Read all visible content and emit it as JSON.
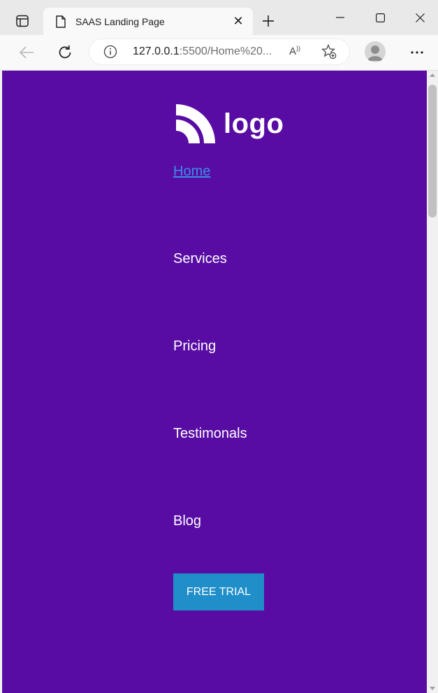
{
  "browser": {
    "tab": {
      "title": "SAAS Landing Page",
      "close_glyph": "✕"
    },
    "new_tab_glyph": "+",
    "address": {
      "url_main": "127.0.0.1",
      "url_rest": ":5500/Home%20...",
      "read_aloud_glyph": "A"
    }
  },
  "page": {
    "logo_text": "logo",
    "nav": [
      {
        "label": "Home",
        "active": true
      },
      {
        "label": "Services",
        "active": false
      },
      {
        "label": "Pricing",
        "active": false
      },
      {
        "label": "Testimonals",
        "active": false
      },
      {
        "label": "Blog",
        "active": false
      }
    ],
    "cta_label": "FREE TRIAL"
  },
  "colors": {
    "page_background": "#580ca4",
    "active_link": "#3b8de6",
    "cta_background": "#1f8ec9"
  },
  "icons": [
    "tab-actions-icon",
    "page-icon",
    "close-icon",
    "plus-icon",
    "minimize-icon",
    "maximize-icon",
    "close-window-icon",
    "back-icon",
    "refresh-icon",
    "info-icon",
    "read-aloud-icon",
    "add-favorite-icon",
    "profile-icon",
    "more-icon"
  ]
}
